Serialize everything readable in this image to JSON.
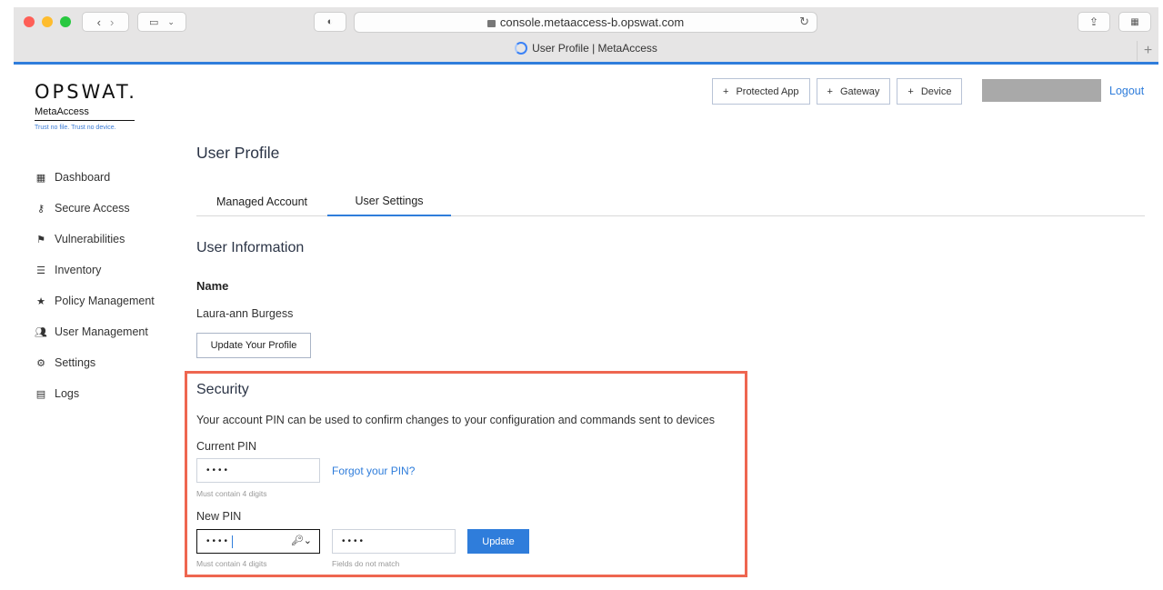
{
  "browser": {
    "url": "console.metaaccess-b.opswat.com",
    "tab_title": "User Profile | MetaAccess",
    "new_tab_symbol": "+"
  },
  "logo": {
    "brand": "OPSWAT.",
    "product": "MetaAccess",
    "tagline": "Trust no file. Trust no device."
  },
  "sidebar": {
    "items": [
      {
        "label": "Dashboard",
        "icon": "grid-icon"
      },
      {
        "label": "Secure Access",
        "icon": "key-icon"
      },
      {
        "label": "Vulnerabilities",
        "icon": "flag-icon"
      },
      {
        "label": "Inventory",
        "icon": "list-icon"
      },
      {
        "label": "Policy Management",
        "icon": "star-icon"
      },
      {
        "label": "User Management",
        "icon": "users-icon"
      },
      {
        "label": "Settings",
        "icon": "gear-icon"
      },
      {
        "label": "Logs",
        "icon": "clipboard-icon"
      }
    ]
  },
  "header": {
    "actions": [
      "Protected App",
      "Gateway",
      "Device"
    ],
    "logout": "Logout"
  },
  "page": {
    "title": "User Profile",
    "tabs": [
      {
        "label": "Managed Account",
        "active": false
      },
      {
        "label": "User Settings",
        "active": true
      }
    ]
  },
  "user_info": {
    "section_title": "User Information",
    "name_label": "Name",
    "name_value": "Laura-ann Burgess",
    "update_profile_button": "Update Your Profile"
  },
  "security": {
    "section_title": "Security",
    "description": "Your account PIN can be used to confirm changes to your configuration and commands sent to devices",
    "current_pin_label": "Current PIN",
    "current_pin_value": "••••",
    "forgot_link": "Forgot your PIN?",
    "current_pin_hint": "Must contain 4 digits",
    "new_pin_label": "New PIN",
    "new_pin_value": "••••",
    "confirm_pin_value": "••••",
    "new_pin_hint": "Must contain 4 digits",
    "confirm_pin_hint": "Fields do not match",
    "update_button": "Update",
    "highlight_color": "#ee6650"
  }
}
